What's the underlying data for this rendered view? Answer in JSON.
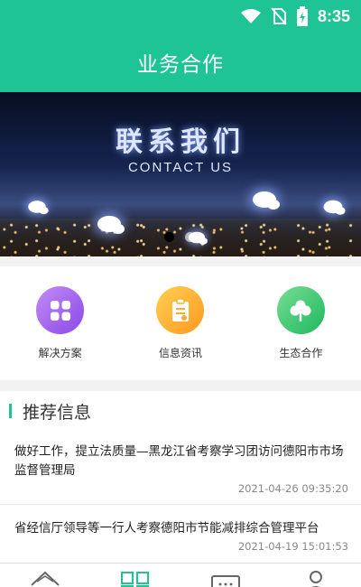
{
  "status_bar": {
    "time": "8:35",
    "icons": [
      "wifi-icon",
      "no-sim-icon",
      "battery-charging-icon"
    ]
  },
  "header": {
    "title": "业务合作"
  },
  "banner": {
    "title": "联系我们",
    "subtitle": "CONTACT US",
    "slide_index": 1,
    "slide_count": 2
  },
  "menu": {
    "items": [
      {
        "label": "解决方案",
        "icon": "apps-grid-icon",
        "color": "#9b5cf0"
      },
      {
        "label": "信息资讯",
        "icon": "clipboard-icon",
        "color": "#ffa726"
      },
      {
        "label": "生态合作",
        "icon": "clover-icon",
        "color": "#2ebf68"
      }
    ]
  },
  "recommend": {
    "title": "推荐信息",
    "items": [
      {
        "title": "做好工作，提立法质量—黑龙江省考察学习团访问德阳市市场监督管理局",
        "date": "2021-04-26 09:35:20"
      },
      {
        "title": "省经信厅领导等一行人考察德阳市节能减排综合管理平台",
        "date": "2021-04-19 15:01:53"
      }
    ]
  },
  "tabbar": {
    "icons": [
      "home-icon",
      "grid-icon",
      "message-icon",
      "profile-icon"
    ],
    "active_index": 1,
    "accent": "#1ec495"
  }
}
